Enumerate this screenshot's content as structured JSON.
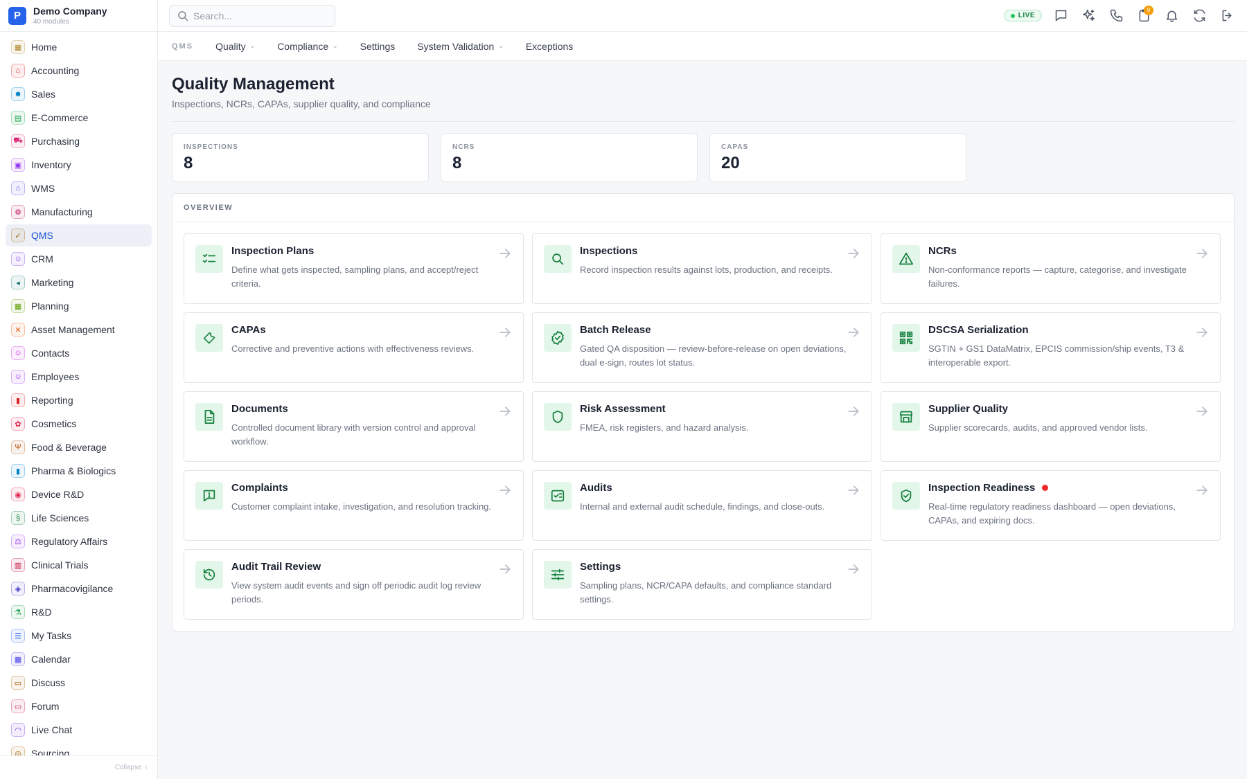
{
  "brand": {
    "logo_letter": "P",
    "name": "Demo Company",
    "sub": "40 modules"
  },
  "sidebar": {
    "items": [
      {
        "label": "Home",
        "icon": "grid-icon",
        "color": "#b08a2e"
      },
      {
        "label": "Accounting",
        "icon": "bank-icon",
        "color": "#dc2626"
      },
      {
        "label": "Sales",
        "icon": "person-icon",
        "color": "#0284c7"
      },
      {
        "label": "E-Commerce",
        "icon": "store-icon",
        "color": "#16a34a"
      },
      {
        "label": "Purchasing",
        "icon": "cart-icon",
        "color": "#db2777"
      },
      {
        "label": "Inventory",
        "icon": "box-icon",
        "color": "#9333ea"
      },
      {
        "label": "WMS",
        "icon": "warehouse-icon",
        "color": "#4f46e5"
      },
      {
        "label": "Manufacturing",
        "icon": "factory-icon",
        "color": "#be185d"
      },
      {
        "label": "QMS",
        "icon": "badge-check-icon",
        "color": "#a16207"
      },
      {
        "label": "CRM",
        "icon": "users-icon",
        "color": "#7c3aed"
      },
      {
        "label": "Marketing",
        "icon": "megaphone-icon",
        "color": "#0f766e"
      },
      {
        "label": "Planning",
        "icon": "calendar-icon",
        "color": "#65a30d"
      },
      {
        "label": "Asset Management",
        "icon": "tools-icon",
        "color": "#ea580c"
      },
      {
        "label": "Contacts",
        "icon": "contact-icon",
        "color": "#c026d3"
      },
      {
        "label": "Employees",
        "icon": "employee-icon",
        "color": "#9333ea"
      },
      {
        "label": "Reporting",
        "icon": "chart-icon",
        "color": "#dc2626"
      },
      {
        "label": "Cosmetics",
        "icon": "flower-icon",
        "color": "#e11d48"
      },
      {
        "label": "Food & Beverage",
        "icon": "fork-icon",
        "color": "#b45309"
      },
      {
        "label": "Pharma & Biologics",
        "icon": "bottle-icon",
        "color": "#0284c7"
      },
      {
        "label": "Device R&D",
        "icon": "chip-icon",
        "color": "#e11d48"
      },
      {
        "label": "Life Sciences",
        "icon": "dna-icon",
        "color": "#15803d"
      },
      {
        "label": "Regulatory Affairs",
        "icon": "gavel-icon",
        "color": "#9333ea"
      },
      {
        "label": "Clinical Trials",
        "icon": "clipboard-icon",
        "color": "#be123c"
      },
      {
        "label": "Pharmacovigilance",
        "icon": "shield-icon",
        "color": "#4338ca"
      },
      {
        "label": "R&D",
        "icon": "flask-icon",
        "color": "#16a34a"
      },
      {
        "label": "My Tasks",
        "icon": "tasks-icon",
        "color": "#2563eb"
      },
      {
        "label": "Calendar",
        "icon": "calendar-icon",
        "color": "#4f46e5"
      },
      {
        "label": "Discuss",
        "icon": "chat-icon",
        "color": "#a16207"
      },
      {
        "label": "Forum",
        "icon": "forum-icon",
        "color": "#be185d"
      },
      {
        "label": "Live Chat",
        "icon": "headset-icon",
        "color": "#6d28d9"
      },
      {
        "label": "Sourcing",
        "icon": "sourcing-icon",
        "color": "#a16207"
      }
    ],
    "active_index": 8,
    "collapse_label": "Collapse"
  },
  "topbar": {
    "search_placeholder": "Search...",
    "live_label": "LIVE",
    "notif_badge": "9",
    "icons": [
      "message-icon",
      "sparkle-icon",
      "phone-icon",
      "clipboard-badge-icon",
      "bell-icon",
      "sync-icon",
      "logout-icon"
    ]
  },
  "subnav": {
    "title": "QMS",
    "items": [
      {
        "label": "Quality",
        "dropdown": true
      },
      {
        "label": "Compliance",
        "dropdown": true
      },
      {
        "label": "Settings",
        "dropdown": false
      },
      {
        "label": "System Validation",
        "dropdown": true
      },
      {
        "label": "Exceptions",
        "dropdown": false
      }
    ]
  },
  "page": {
    "title": "Quality Management",
    "subtitle": "Inspections, NCRs, CAPAs, supplier quality, and compliance"
  },
  "stats": [
    {
      "label": "INSPECTIONS",
      "value": "8"
    },
    {
      "label": "NCRS",
      "value": "8"
    },
    {
      "label": "CAPAS",
      "value": "20"
    }
  ],
  "overview": {
    "heading": "OVERVIEW",
    "accent_color": "#15803d",
    "cards": [
      {
        "title": "Inspection Plans",
        "desc": "Define what gets inspected, sampling plans, and accept/reject criteria.",
        "icon": "checklist-icon"
      },
      {
        "title": "Inspections",
        "desc": "Record inspection results against lots, production, and receipts.",
        "icon": "search-icon"
      },
      {
        "title": "NCRs",
        "desc": "Non-conformance reports — capture, categorise, and investigate failures.",
        "icon": "warning-icon"
      },
      {
        "title": "CAPAs",
        "desc": "Corrective and preventive actions with effectiveness reviews.",
        "icon": "wrench-icon"
      },
      {
        "title": "Batch Release",
        "desc": "Gated QA disposition — review-before-release on open deviations, dual e-sign, routes lot status.",
        "icon": "badge-check-icon"
      },
      {
        "title": "DSCSA Serialization",
        "desc": "SGTIN + GS1 DataMatrix, EPCIS commission/ship events, T3 & interoperable export.",
        "icon": "qr-code-icon"
      },
      {
        "title": "Documents",
        "desc": "Controlled document library with version control and approval workflow.",
        "icon": "document-icon"
      },
      {
        "title": "Risk Assessment",
        "desc": "FMEA, risk registers, and hazard analysis.",
        "icon": "shield-icon"
      },
      {
        "title": "Supplier Quality",
        "desc": "Supplier scorecards, audits, and approved vendor lists.",
        "icon": "store-icon"
      },
      {
        "title": "Complaints",
        "desc": "Customer complaint intake, investigation, and resolution tracking.",
        "icon": "comment-alert-icon"
      },
      {
        "title": "Audits",
        "desc": "Internal and external audit schedule, findings, and close-outs.",
        "icon": "checkbox-list-icon"
      },
      {
        "title": "Inspection Readiness",
        "desc": "Real-time regulatory readiness dashboard — open deviations, CAPAs, and expiring docs.",
        "icon": "shield-check-icon",
        "alert": true
      },
      {
        "title": "Audit Trail Review",
        "desc": "View system audit events and sign off periodic audit log review periods.",
        "icon": "history-icon"
      },
      {
        "title": "Settings",
        "desc": "Sampling plans, NCR/CAPA defaults, and compliance standard settings.",
        "icon": "sliders-icon"
      }
    ]
  }
}
